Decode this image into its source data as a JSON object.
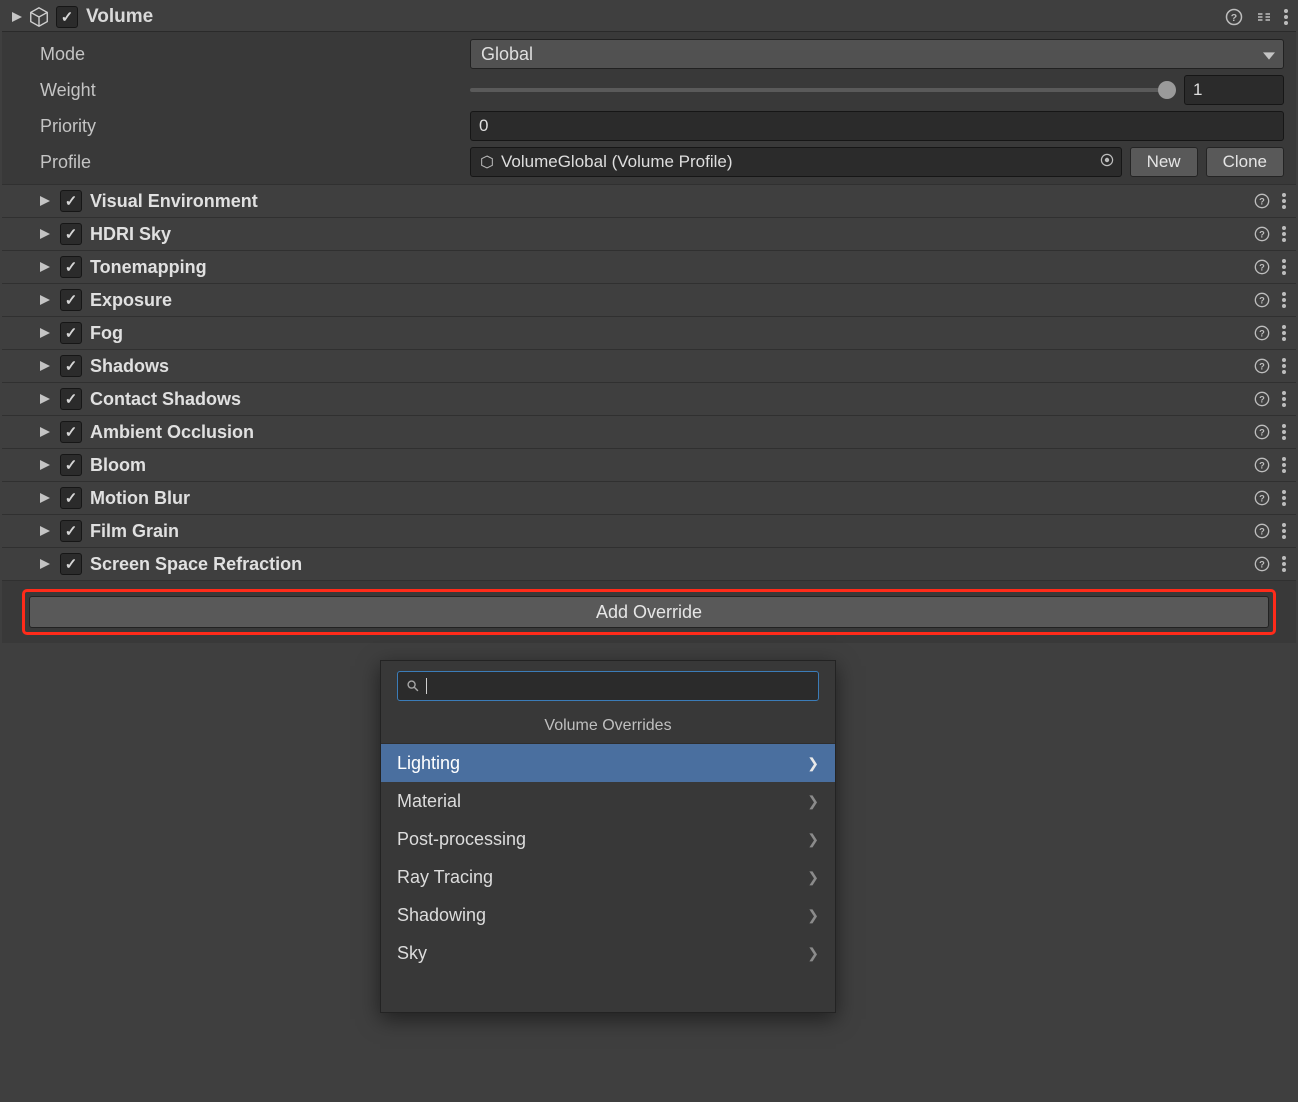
{
  "component": {
    "title": "Volume",
    "enabled": true
  },
  "props": {
    "mode": {
      "label": "Mode",
      "value": "Global"
    },
    "weight": {
      "label": "Weight",
      "value": "1"
    },
    "priority": {
      "label": "Priority",
      "value": "0"
    },
    "profile": {
      "label": "Profile",
      "value": "VolumeGlobal (Volume Profile)",
      "new_btn": "New",
      "clone_btn": "Clone"
    }
  },
  "overrides": [
    {
      "label": "Visual Environment",
      "enabled": true
    },
    {
      "label": "HDRI Sky",
      "enabled": true
    },
    {
      "label": "Tonemapping",
      "enabled": true
    },
    {
      "label": "Exposure",
      "enabled": true
    },
    {
      "label": "Fog",
      "enabled": true
    },
    {
      "label": "Shadows",
      "enabled": true
    },
    {
      "label": "Contact Shadows",
      "enabled": true
    },
    {
      "label": "Ambient Occlusion",
      "enabled": true
    },
    {
      "label": "Bloom",
      "enabled": true
    },
    {
      "label": "Motion Blur",
      "enabled": true
    },
    {
      "label": "Film Grain",
      "enabled": true
    },
    {
      "label": "Screen Space Refraction",
      "enabled": true
    }
  ],
  "add_override_label": "Add Override",
  "popup": {
    "title": "Volume Overrides",
    "search_value": "",
    "items": [
      {
        "label": "Lighting",
        "selected": true
      },
      {
        "label": "Material",
        "selected": false
      },
      {
        "label": "Post-processing",
        "selected": false
      },
      {
        "label": "Ray Tracing",
        "selected": false
      },
      {
        "label": "Shadowing",
        "selected": false
      },
      {
        "label": "Sky",
        "selected": false
      }
    ]
  }
}
